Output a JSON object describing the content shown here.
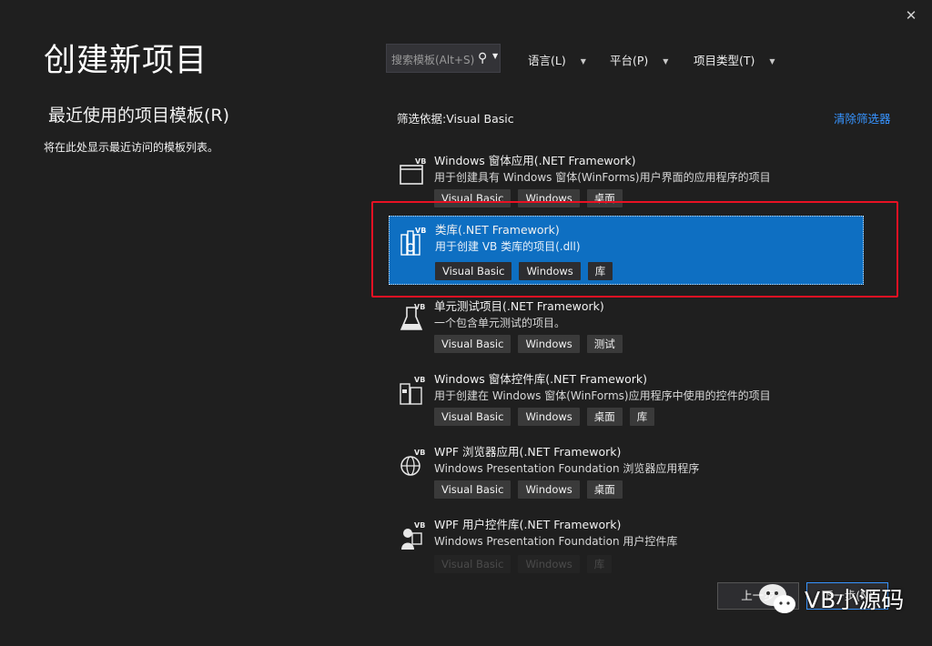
{
  "window": {
    "close_glyph": "✕"
  },
  "page_title": "创建新项目",
  "recent": {
    "title": "最近使用的项目模板(R)",
    "description": "将在此处显示最近访问的模板列表。"
  },
  "search": {
    "placeholder": "搜索模板(Alt+S)"
  },
  "filters": [
    {
      "label": "语言(L)"
    },
    {
      "label": "平台(P)"
    },
    {
      "label": "项目类型(T)"
    }
  ],
  "filter_by": "筛选依据:Visual Basic",
  "clear_filters": "清除筛选器",
  "templates": [
    {
      "name": "Windows 窗体应用(.NET Framework)",
      "description": "用于创建具有 Windows 窗体(WinForms)用户界面的应用程序的项目",
      "tags": [
        "Visual Basic",
        "Windows",
        "桌面"
      ],
      "icon": "winforms-app-icon"
    },
    {
      "name": "类库(.NET Framework)",
      "description": "用于创建 VB 类库的项目(.dll)",
      "tags": [
        "Visual Basic",
        "Windows",
        "库"
      ],
      "icon": "class-library-icon",
      "selected": true
    },
    {
      "name": "单元测试项目(.NET Framework)",
      "description": "一个包含单元测试的项目。",
      "tags": [
        "Visual Basic",
        "Windows",
        "测试"
      ],
      "icon": "unit-test-icon"
    },
    {
      "name": "Windows 窗体控件库(.NET Framework)",
      "description": "用于创建在 Windows 窗体(WinForms)应用程序中使用的控件的项目",
      "tags": [
        "Visual Basic",
        "Windows",
        "桌面",
        "库"
      ],
      "icon": "control-library-icon"
    },
    {
      "name": "WPF 浏览器应用(.NET Framework)",
      "description": "Windows Presentation Foundation 浏览器应用程序",
      "tags": [
        "Visual Basic",
        "Windows",
        "桌面"
      ],
      "icon": "wpf-browser-app-icon"
    },
    {
      "name": "WPF 用户控件库(.NET Framework)",
      "description": "Windows Presentation Foundation 用户控件库",
      "tags": [
        "Visual Basic",
        "Windows",
        "库"
      ],
      "icon": "wpf-user-control-library-icon"
    }
  ],
  "buttons": {
    "back": "上一步",
    "next": "下一步(N)"
  },
  "watermark": {
    "text": "VB小源码"
  },
  "colors": {
    "accent": "#0e6fc2",
    "highlight": "#e81123",
    "link": "#3794ff",
    "background": "#1f1f1f"
  }
}
